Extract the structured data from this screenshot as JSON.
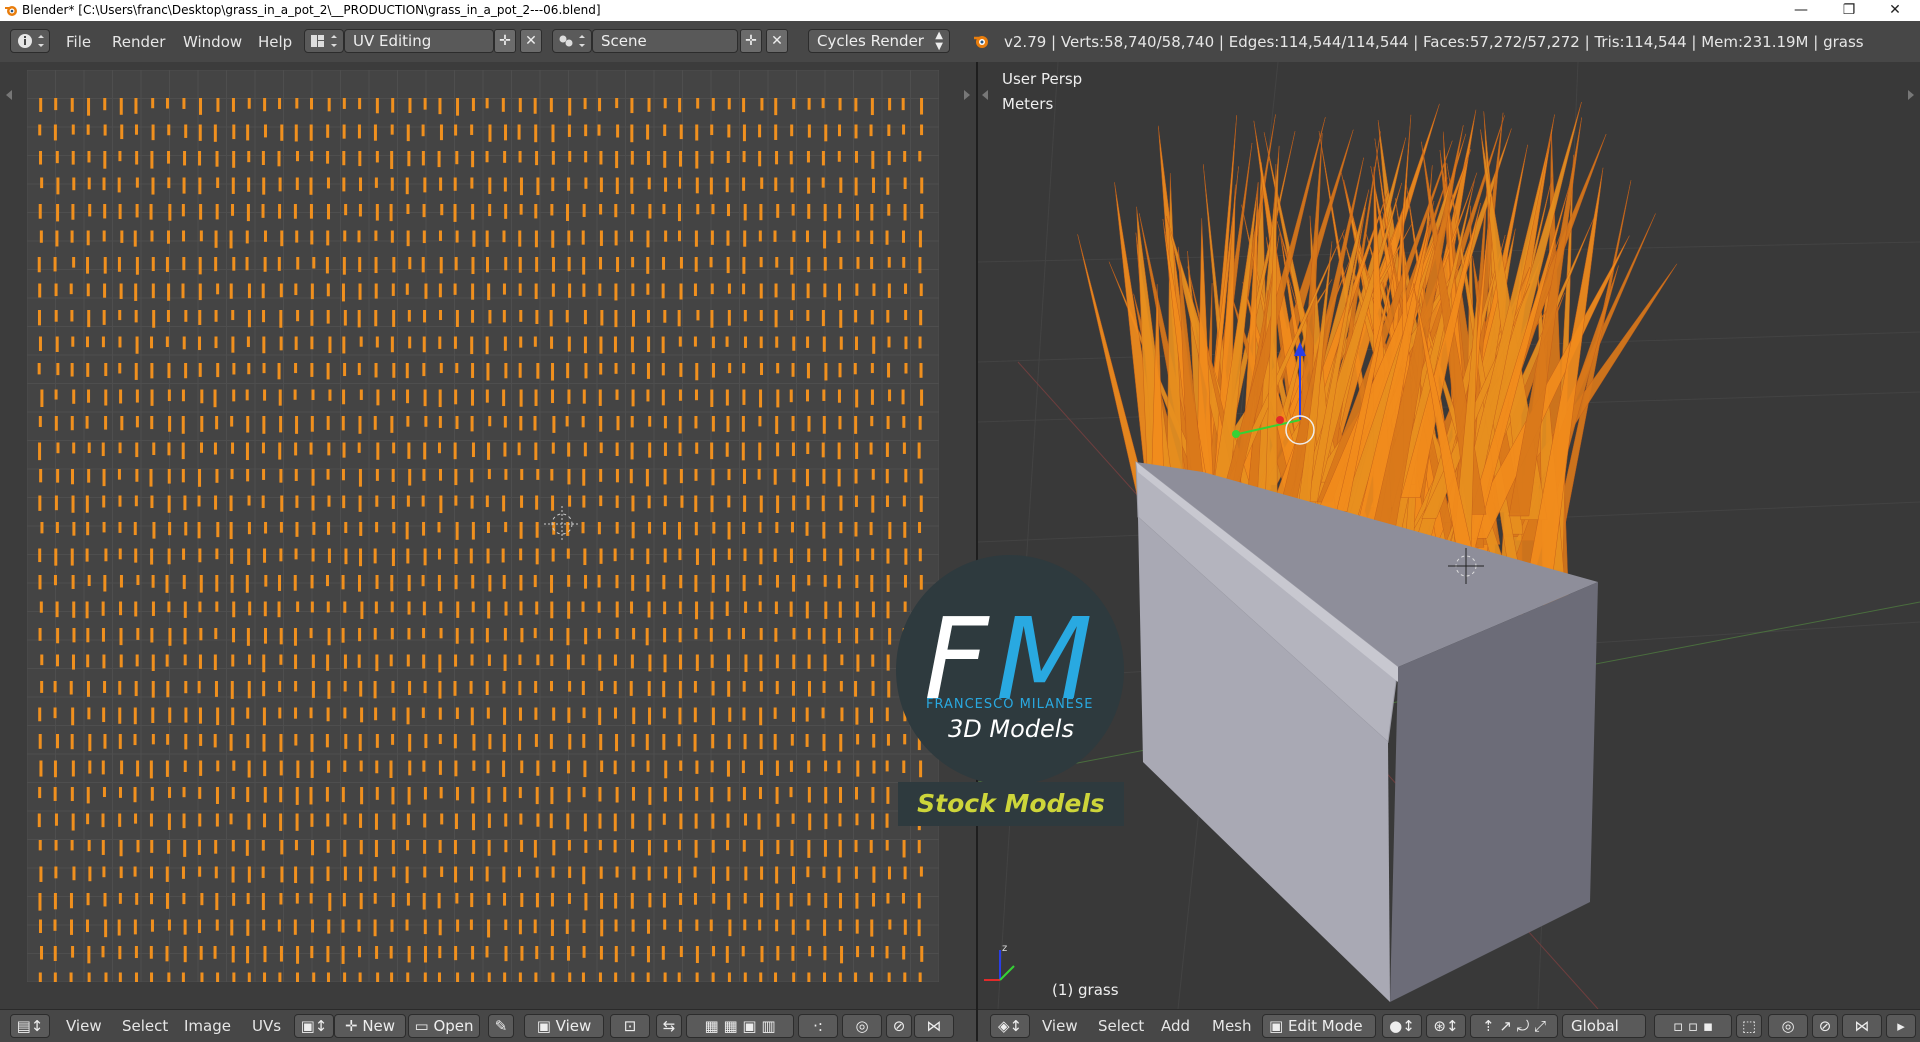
{
  "window": {
    "title": "Blender* [C:\\Users\\franc\\Desktop\\grass_in_a_pot_2\\__PRODUCTION\\grass_in_a_pot_2---06.blend]",
    "minimize_glyph": "—",
    "restore_glyph": "❐",
    "close_glyph": "✕"
  },
  "info_header": {
    "menus": [
      "File",
      "Render",
      "Window",
      "Help"
    ],
    "screen_layout": "UV Editing",
    "scene": "Scene",
    "render_engine": "Cycles Render",
    "stats": "v2.79 | Verts:58,740/58,740 | Edges:114,544/114,544 | Faces:57,272/57,272 | Tris:114,544 | Mem:231.19M | grass"
  },
  "uv_editor": {
    "footer_menus": [
      "View",
      "Select",
      "Image",
      "UVs"
    ],
    "new_label": "New",
    "open_label": "Open",
    "view_label": "View",
    "island_color": "#f0901e"
  },
  "viewport": {
    "view_name": "User Persp",
    "units": "Meters",
    "object_label": "(1) grass",
    "footer_menus": [
      "View",
      "Select",
      "Add",
      "Mesh"
    ],
    "mode": "Edit Mode",
    "orientation": "Global",
    "grass_color": "#f28c1c",
    "pot_color": "#a6a6b0"
  },
  "watermark": {
    "letter_f": "F",
    "letter_m": "M",
    "name": "FRANCESCO MILANESE",
    "tagline": "3D Models",
    "stock": "Stock Models"
  }
}
